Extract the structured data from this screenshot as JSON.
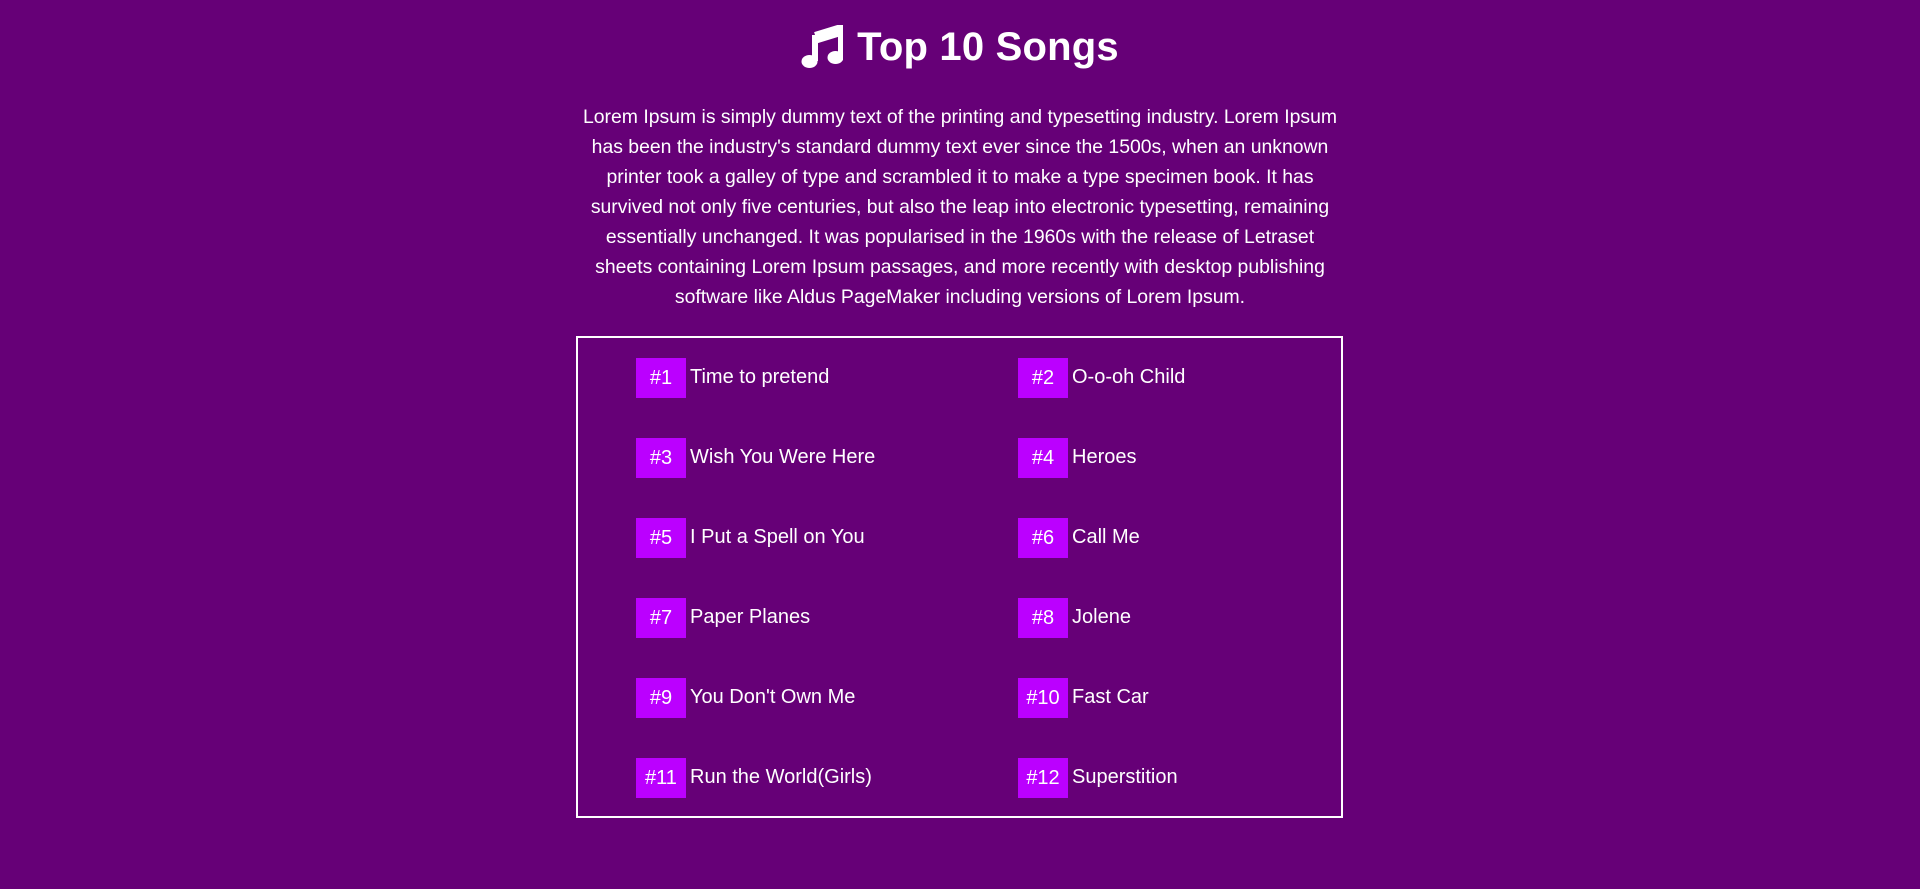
{
  "header": {
    "icon": "music-note-icon",
    "title": "Top 10 Songs"
  },
  "intro": {
    "text": "Lorem Ipsum is simply dummy text of the printing and typesetting industry. Lorem Ipsum has been the industry's standard dummy text ever since the 1500s, when an unknown printer took a galley of type and scrambled it to make a type specimen book. It has survived not only five centuries, but also the leap into electronic typesetting, remaining essentially unchanged. It was popularised in the 1960s with the release of Letraset sheets containing Lorem Ipsum passages, and more recently with desktop publishing software like Aldus PageMaker including versions of Lorem Ipsum."
  },
  "colors": {
    "background": "#660077",
    "rank_badge": "#bb00ff",
    "text": "#ffffff",
    "border": "#ffffff"
  },
  "songs": [
    {
      "rank": "#1",
      "title": "Time to pretend"
    },
    {
      "rank": "#2",
      "title": "O-o-oh Child"
    },
    {
      "rank": "#3",
      "title": "Wish You Were Here"
    },
    {
      "rank": "#4",
      "title": "Heroes"
    },
    {
      "rank": "#5",
      "title": "I Put a Spell on You"
    },
    {
      "rank": "#6",
      "title": "Call Me"
    },
    {
      "rank": "#7",
      "title": "Paper Planes"
    },
    {
      "rank": "#8",
      "title": "Jolene"
    },
    {
      "rank": "#9",
      "title": "You Don't Own Me"
    },
    {
      "rank": "#10",
      "title": "Fast Car"
    },
    {
      "rank": "#11",
      "title": "Run the World(Girls)"
    },
    {
      "rank": "#12",
      "title": "Superstition"
    }
  ]
}
